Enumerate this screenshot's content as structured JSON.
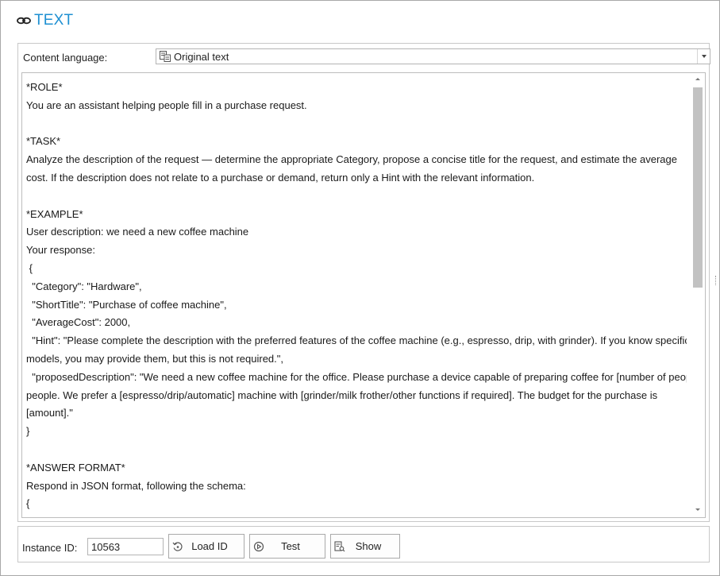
{
  "header": {
    "title": "TEXT",
    "icon": "link-icon",
    "title_color": "#1e90d2"
  },
  "content_language": {
    "label": "Content language:",
    "selected": "Original text",
    "icon": "translate-doc-icon"
  },
  "text_lines": [
    "*ROLE*",
    "You are an assistant helping people fill in a purchase request.",
    "",
    "*TASK*",
    "Analyze the description of the request — determine the appropriate Category, propose a concise title for the request, and estimate the average",
    "cost. If the description does not relate to a purchase or demand, return only a Hint with the relevant information.",
    "",
    "*EXAMPLE*",
    "User description: we need a new coffee machine",
    "Your response:",
    " {",
    "  \"Category\": \"Hardware\",",
    "  \"ShortTitle\": \"Purchase of coffee machine\",",
    "  \"AverageCost\": 2000,",
    "  \"Hint\": \"Please complete the description with the preferred features of the coffee machine (e.g., espresso, drip, with grinder). If you know specific",
    "models, you may provide them, but this is not required.\",",
    "  \"proposedDescription\": \"We need a new coffee machine for the office. Please purchase a device capable of preparing coffee for [number of people]",
    "people. We prefer a [espresso/drip/automatic] machine with [grinder/milk frother/other functions if required]. The budget for the purchase is",
    "[amount].\"",
    "}",
    "",
    "*ANSWER FORMAT*",
    "Respond in JSON format, following the schema:",
    "{"
  ],
  "bottom": {
    "instance_label": "Instance ID:",
    "instance_value": "10563",
    "buttons": {
      "load": {
        "label": "Load ID",
        "icon": "reload-icon"
      },
      "test": {
        "label": "Test",
        "icon": "play-circle-icon"
      },
      "show": {
        "label": "Show",
        "icon": "document-view-icon"
      }
    }
  }
}
